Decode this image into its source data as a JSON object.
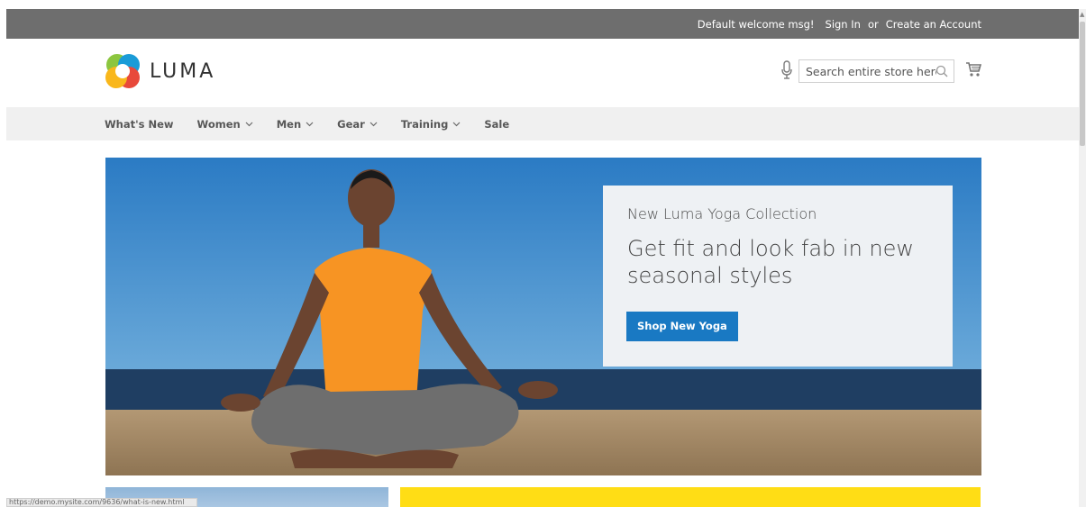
{
  "topbar": {
    "welcome": "Default welcome msg!",
    "sign_in": "Sign In",
    "or": "or",
    "create_account": "Create an Account"
  },
  "header": {
    "logo_text": "LUMA",
    "search": {
      "placeholder": "Search entire store here..."
    }
  },
  "nav": {
    "items": [
      {
        "label": "What's New",
        "has_dropdown": false
      },
      {
        "label": "Women",
        "has_dropdown": true
      },
      {
        "label": "Men",
        "has_dropdown": true
      },
      {
        "label": "Gear",
        "has_dropdown": true
      },
      {
        "label": "Training",
        "has_dropdown": true
      },
      {
        "label": "Sale",
        "has_dropdown": false
      }
    ]
  },
  "hero": {
    "subtitle": "New Luma Yoga Collection",
    "title": "Get fit and look fab in new seasonal styles",
    "button": "Shop New Yoga"
  },
  "statusbar": {
    "url": "https://demo.mysite.com/9636/what-is-new.html"
  },
  "icons": {
    "mic": "microphone-icon",
    "search": "magnifier-icon",
    "cart": "shopping-cart-icon"
  },
  "colors": {
    "topbar": "#6e6e6e",
    "nav_bg": "#f0f0f0",
    "primary_button": "#1979c3",
    "promo_yellow": "#ffdd15"
  }
}
